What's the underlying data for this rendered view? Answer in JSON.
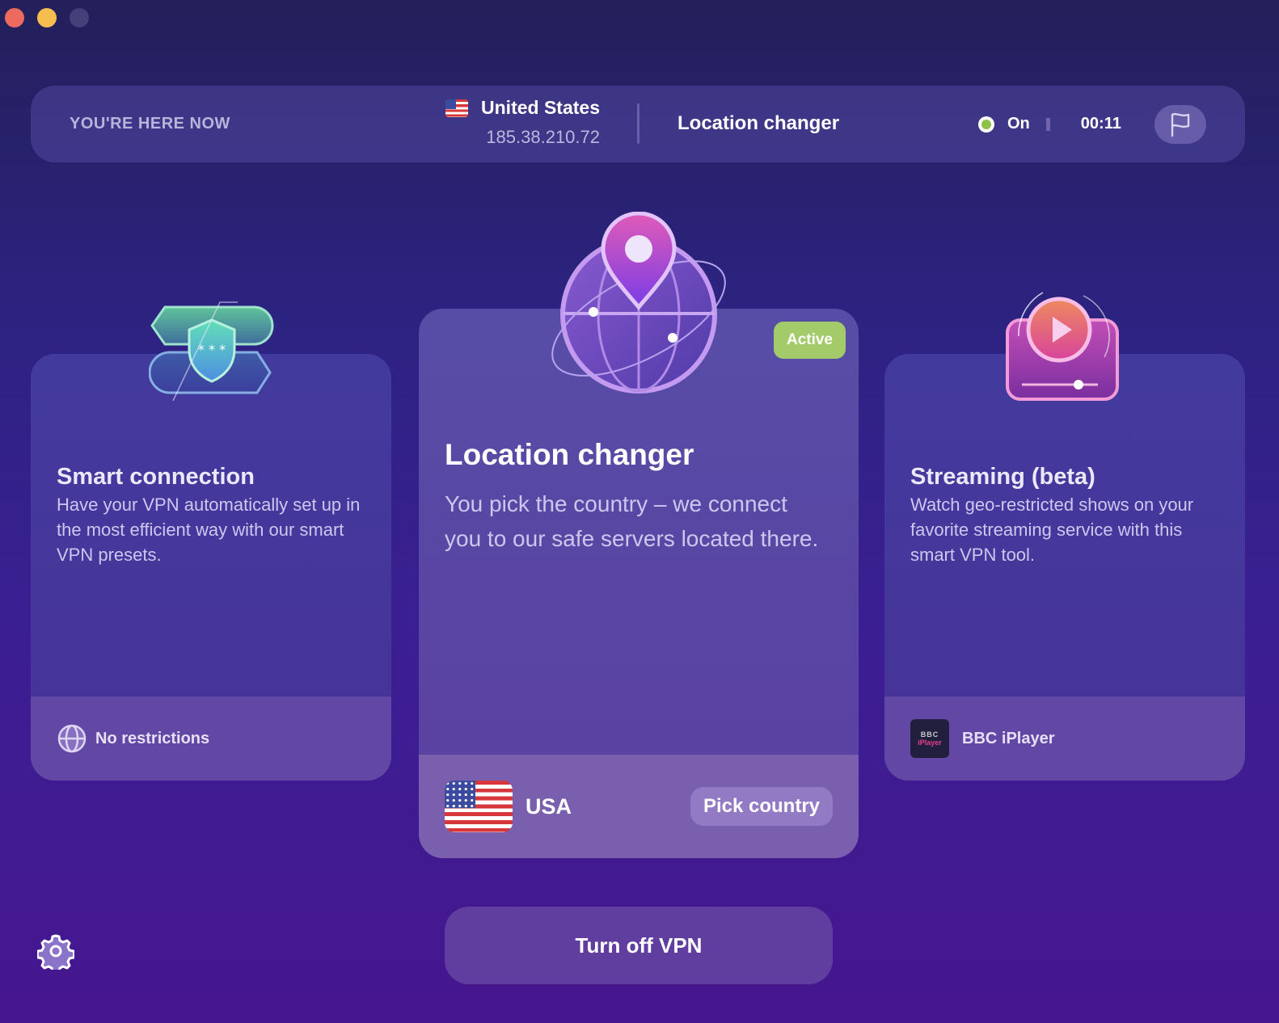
{
  "window": {
    "controls": [
      "close",
      "minimize",
      "maximize"
    ]
  },
  "topbar": {
    "here_label": "YOU'RE HERE NOW",
    "country": "United States",
    "country_flag": "us-flag",
    "ip": "185.38.210.72",
    "mode": "Location changer",
    "status": "On",
    "status_color": "#8ec24a",
    "timer": "00:11",
    "flag_button_icon": "flag-icon"
  },
  "cards": {
    "smart": {
      "title": "Smart connection",
      "description": "Have your VPN automatically set up in the most efficient way with our smart VPN presets.",
      "footer": "No restrictions",
      "footer_icon": "globe-icon"
    },
    "location": {
      "title": "Location changer",
      "badge": "Active",
      "badge_color": "#a3cb69",
      "description": "You pick the country – we connect you to our safe servers located there.",
      "country": "USA",
      "pick_label": "Pick country"
    },
    "streaming": {
      "title": "Streaming (beta)",
      "description": "Watch geo-restricted shows on your favorite streaming service with this smart VPN tool.",
      "footer": "BBC iPlayer",
      "logo_top": "BBC",
      "logo_bottom": "iPlayer"
    }
  },
  "actions": {
    "turn_off": "Turn off VPN",
    "settings_icon": "gear-icon"
  }
}
